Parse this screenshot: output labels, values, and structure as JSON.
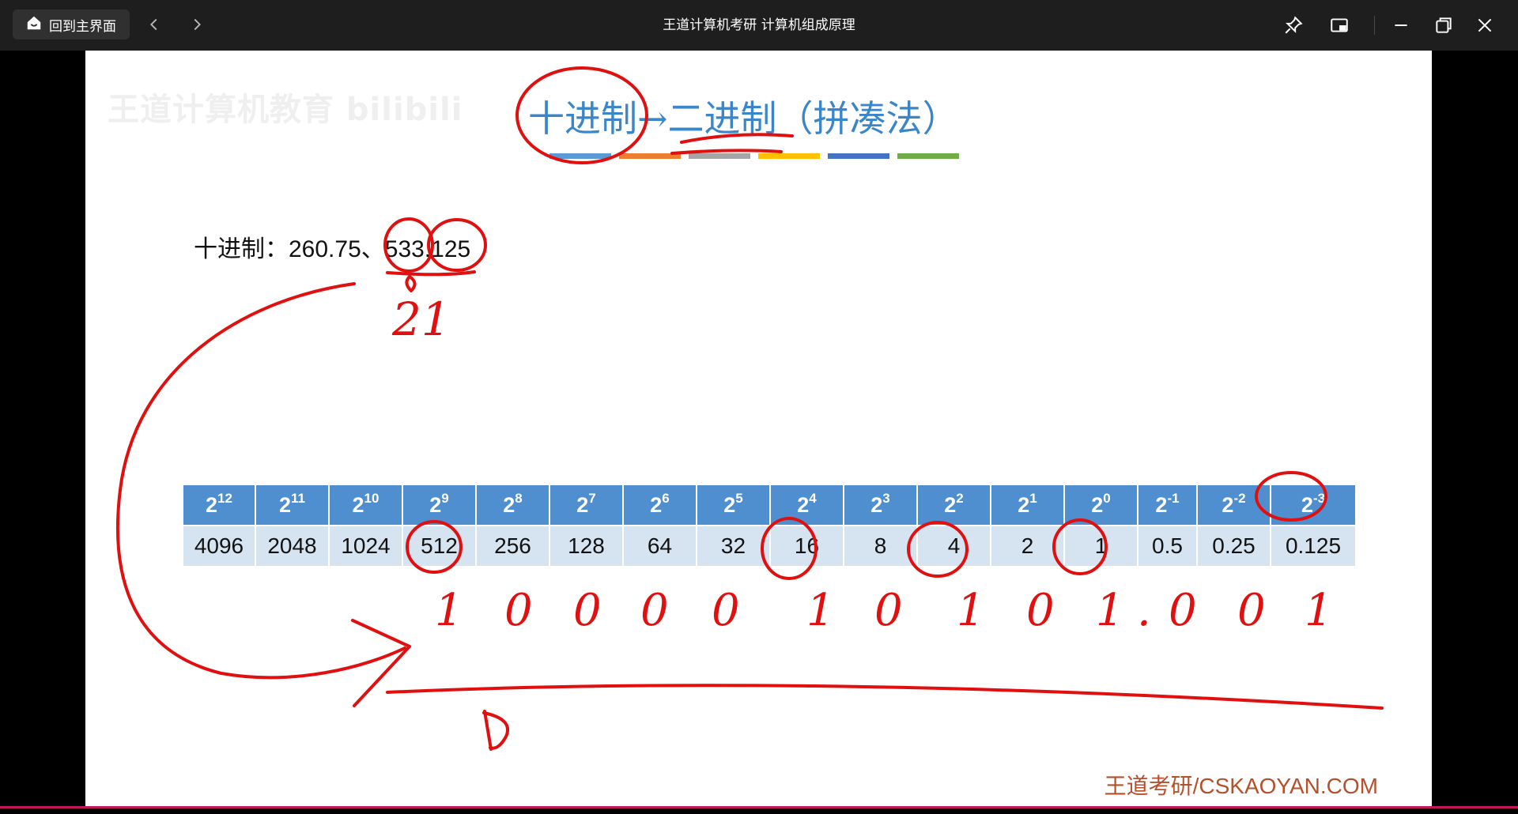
{
  "titlebar": {
    "home_label": "回到主界面",
    "title": "王道计算机考研 计算机组成原理"
  },
  "slide": {
    "watermark": "王道计算机教育 bilibili",
    "title": "十进制→二进制（拼凑法）",
    "decimal_label": "十进制：",
    "decimal_values": "260.75、533.125",
    "brand": "王道考研/CSKAOYAN.COM",
    "bar_colors": [
      "#5b9bd5",
      "#ed7d31",
      "#a5a5a5",
      "#ffc000",
      "#4472c4",
      "#70ad47"
    ],
    "powers": [
      {
        "base": "2",
        "exp": "12",
        "value": "4096"
      },
      {
        "base": "2",
        "exp": "11",
        "value": "2048"
      },
      {
        "base": "2",
        "exp": "10",
        "value": "1024"
      },
      {
        "base": "2",
        "exp": "9",
        "value": "512"
      },
      {
        "base": "2",
        "exp": "8",
        "value": "256"
      },
      {
        "base": "2",
        "exp": "7",
        "value": "128"
      },
      {
        "base": "2",
        "exp": "6",
        "value": "64"
      },
      {
        "base": "2",
        "exp": "5",
        "value": "32"
      },
      {
        "base": "2",
        "exp": "4",
        "value": "16"
      },
      {
        "base": "2",
        "exp": "3",
        "value": "8"
      },
      {
        "base": "2",
        "exp": "2",
        "value": "4"
      },
      {
        "base": "2",
        "exp": "1",
        "value": "2"
      },
      {
        "base": "2",
        "exp": "0",
        "value": "1"
      },
      {
        "base": "2",
        "exp": "-1",
        "value": "0.5"
      },
      {
        "base": "2",
        "exp": "-2",
        "value": "0.25"
      },
      {
        "base": "2",
        "exp": "-3",
        "value": "0.125"
      }
    ]
  },
  "annotations": {
    "ink_color": "#e01010",
    "note_21": "21",
    "binary_digits": "1000010101.001",
    "note_d": "D"
  }
}
